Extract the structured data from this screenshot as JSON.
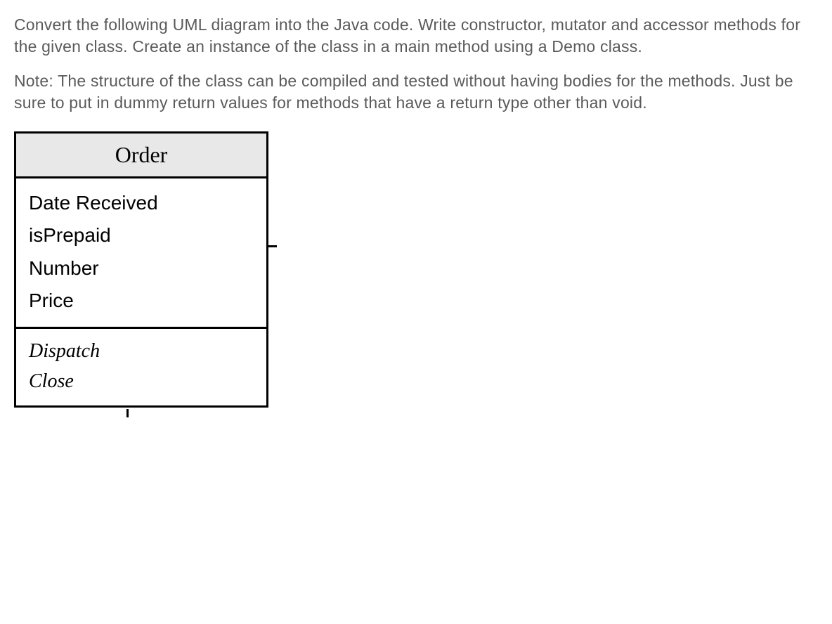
{
  "paragraphs": {
    "p1": "Convert the following UML diagram into the Java code. Write constructor, mutator and accessor methods for the given class. Create an instance of the class  in a main method using a Demo class.",
    "p2": "Note: The structure of the class can be compiled and tested without having bodies for the methods. Just be sure to put in dummy return values for methods that have a return type other than void."
  },
  "uml": {
    "className": "Order",
    "attributes": {
      "a0": "Date Received",
      "a1": "isPrepaid",
      "a2": "Number",
      "a3": "Price"
    },
    "methods": {
      "m0": "Dispatch",
      "m1": "Close"
    }
  }
}
